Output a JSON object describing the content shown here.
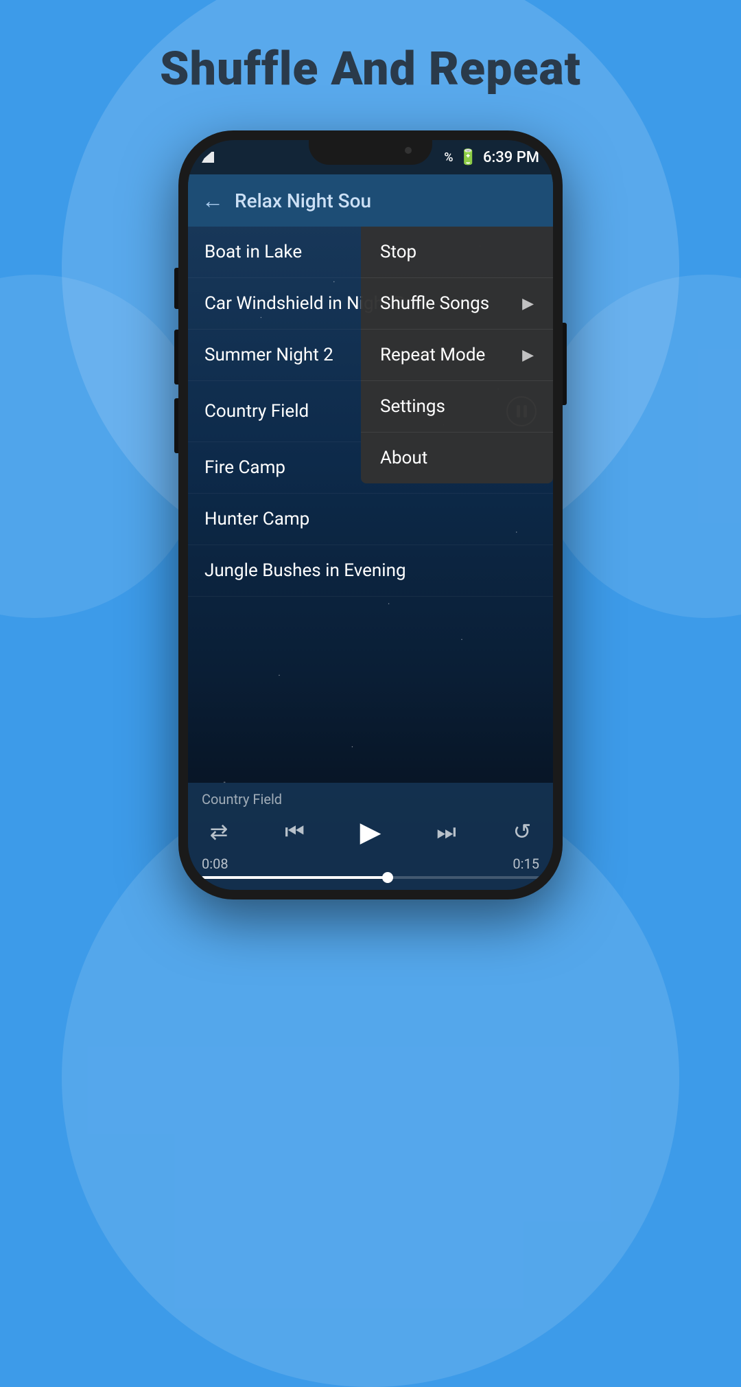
{
  "page": {
    "title": "Shuffle And Repeat",
    "background_color": "#3d9be9"
  },
  "phone": {
    "status_bar": {
      "time": "6:39 PM",
      "battery": "🔋"
    },
    "toolbar": {
      "title": "Relax Night Sou",
      "back_label": "←"
    },
    "songs": [
      {
        "id": 1,
        "name": "Boat in Lake",
        "playing": false
      },
      {
        "id": 2,
        "name": "Car Windshield in Night Rain",
        "playing": false
      },
      {
        "id": 3,
        "name": "Summer Night 2",
        "playing": false
      },
      {
        "id": 4,
        "name": "Country Field",
        "playing": true
      },
      {
        "id": 5,
        "name": "Fire Camp",
        "playing": false
      },
      {
        "id": 6,
        "name": "Hunter Camp",
        "playing": false
      },
      {
        "id": 7,
        "name": "Jungle Bushes in Evening",
        "playing": false
      }
    ],
    "player": {
      "now_playing": "Country Field",
      "time_current": "0:08",
      "time_total": "0:15",
      "progress_percent": 55
    },
    "context_menu": {
      "items": [
        {
          "id": 1,
          "label": "Stop",
          "has_arrow": false
        },
        {
          "id": 2,
          "label": "Shuffle Songs",
          "has_arrow": true
        },
        {
          "id": 3,
          "label": "Repeat Mode",
          "has_arrow": true
        },
        {
          "id": 4,
          "label": "Settings",
          "has_arrow": false
        },
        {
          "id": 5,
          "label": "About",
          "has_arrow": false
        }
      ]
    }
  }
}
